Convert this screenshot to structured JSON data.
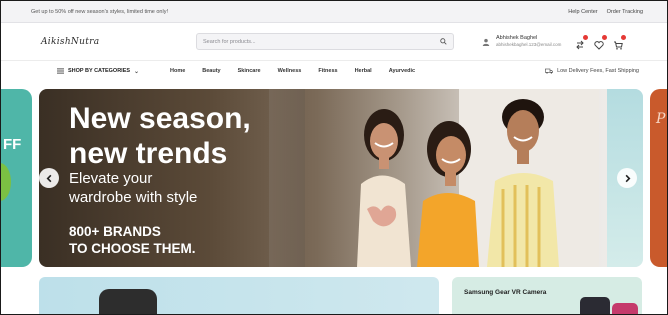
{
  "topbar": {
    "promo": "Get up to 50% off new season's styles, limited time only!",
    "links": [
      "Help Center",
      "Order Tracking"
    ]
  },
  "header": {
    "logo_main": "AikishNutra",
    "search_placeholder": "Search for products...",
    "account_name": "Abhishek Baghel",
    "account_email": "abhishekbaghel.123@email.com",
    "icons": [
      "compare-icon",
      "wishlist-icon",
      "cart-icon"
    ]
  },
  "nav": {
    "categories_label": "SHOP BY CATEGORIES",
    "links": [
      "Home",
      "Beauty",
      "Skincare",
      "Wellness",
      "Fitness",
      "Herbal",
      "Ayurvedic"
    ],
    "delivery_text": "Low Delivery Fees, Fast Shipping"
  },
  "hero": {
    "title_line1": "New season,",
    "title_line2": "new trends",
    "subtitle_line1": "Elevate your",
    "subtitle_line2": "wardrobe with style",
    "brands_line1": "800+ BRANDS",
    "brands_line2": "TO CHOOSE THEM.",
    "side_left_text": "FF",
    "side_right_text": "P"
  },
  "cards": {
    "right_label": "Samsung Gear VR Camera"
  },
  "colors": {
    "accent_teal": "#4fb6a8",
    "badge_red": "#e53935",
    "side_orange": "#c95a2c"
  }
}
